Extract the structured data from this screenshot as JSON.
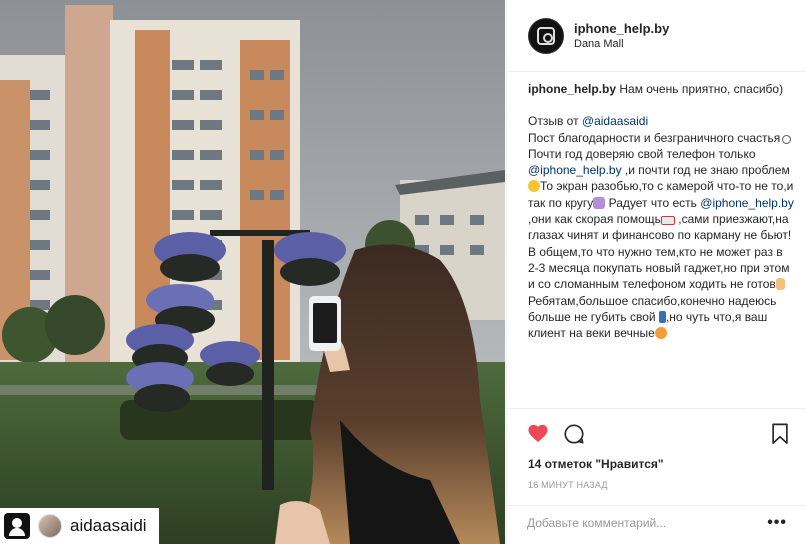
{
  "photo": {
    "repost_username": "aidaasaidi"
  },
  "post": {
    "author": "iphone_help.by",
    "location": "Dana Mall"
  },
  "caption": {
    "author": "iphone_help.by",
    "intro_text": " Нам очень приятно, спасибо)",
    "review_prefix": "Отзыв от ",
    "review_mention": "@aidaasaidi",
    "line_thanks": "Пост благодарности и безграничного счастья",
    "seg1": "Почти год доверяю свой телефон только ",
    "mention2": "@iphone_help.by",
    "seg2": " ,и почти год не знаю проблем",
    "seg3": "То экран разобью,то с камерой что-то не то,и так по кругу",
    "seg4": " Радует что есть ",
    "mention3": "@iphone_help.by",
    "seg5": " ,они как скорая помощь",
    "seg6": " ,сами приезжают,на глазах чинят и финансово по карману не бьют!В общем,то что нужно тем,кто не может раз в 2-3 месяца покупать новый гаджет,но при этом и со сломанным телефоном ходить не готов",
    "seg7": " Ребятам,большое спасибо,конечно надеюсь больше не губить свой ",
    "seg8": ",но чуть что,я ваш клиент на веки вечные"
  },
  "actions": {
    "likes_label": "14 отметок \"Нравится\"",
    "time_label": "16 МИНУТ НАЗАД",
    "comment_placeholder": "Добавьте комментарий...",
    "more_label": "•••",
    "like_color": "#ed4956"
  },
  "icons": {
    "like": "heart-icon",
    "comment": "comment-bubble-icon",
    "save": "bookmark-icon"
  }
}
